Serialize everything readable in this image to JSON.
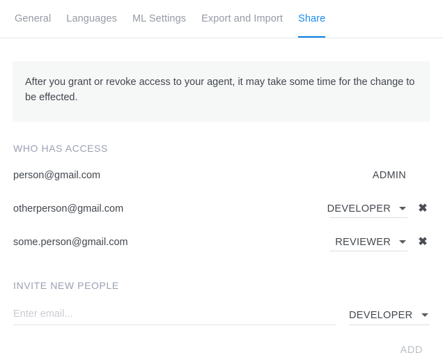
{
  "tabs": [
    {
      "label": "General",
      "active": false
    },
    {
      "label": "Languages",
      "active": false
    },
    {
      "label": "ML Settings",
      "active": false
    },
    {
      "label": "Export and Import",
      "active": false
    },
    {
      "label": "Share",
      "active": true
    }
  ],
  "notice": {
    "text": "After you grant or revoke access to your agent, it may take some time for the change to be effected."
  },
  "who_has_access": {
    "title": "WHO HAS ACCESS",
    "rows": [
      {
        "email": "person@gmail.com",
        "role": "ADMIN",
        "editable": false,
        "removable": false
      },
      {
        "email": "otherperson@gmail.com",
        "role": "DEVELOPER",
        "editable": true,
        "removable": true
      },
      {
        "email": "some.person@gmail.com",
        "role": "REVIEWER",
        "editable": true,
        "removable": true
      }
    ],
    "delete_icon": "✖"
  },
  "invite": {
    "title": "INVITE NEW PEOPLE",
    "email_placeholder": "Enter email...",
    "email_value": "",
    "role": "DEVELOPER",
    "add_label": "ADD"
  },
  "colors": {
    "accent": "#1a8bf0",
    "tab_underline": "#0a7fe0",
    "tab_inactive": "#959aa3",
    "section_title": "#9aa0b0",
    "notice_bg": "#f6f7f7",
    "text": "#42474d",
    "add_disabled": "#bcc0c6"
  }
}
